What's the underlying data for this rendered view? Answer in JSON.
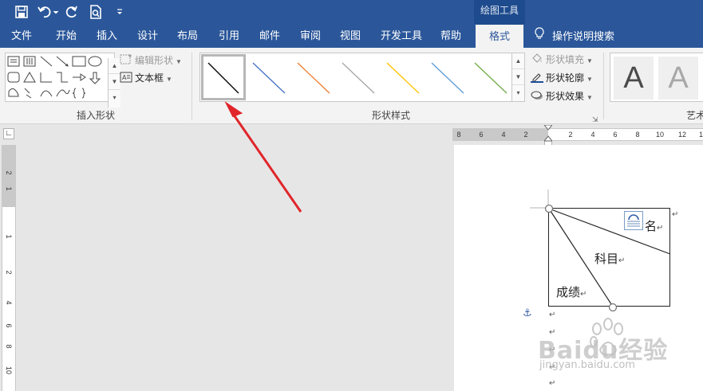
{
  "title_bar": {
    "contextual_group": "绘图工具"
  },
  "tabs": [
    {
      "label": "文件"
    },
    {
      "label": "开始"
    },
    {
      "label": "插入"
    },
    {
      "label": "设计"
    },
    {
      "label": "布局"
    },
    {
      "label": "引用"
    },
    {
      "label": "邮件"
    },
    {
      "label": "审阅"
    },
    {
      "label": "视图"
    },
    {
      "label": "开发工具"
    },
    {
      "label": "帮助"
    },
    {
      "label": "格式"
    }
  ],
  "active_tab": "格式",
  "tell_me": "操作说明搜索",
  "ribbon": {
    "insert_shapes": {
      "group_label": "插入形状",
      "edit_shape": "编辑形状",
      "text_box": "文本框"
    },
    "shape_styles": {
      "group_label": "形状样式",
      "line_colors": [
        "#000000",
        "#4472c4",
        "#ed7d31",
        "#a5a5a5",
        "#ffc000",
        "#5b9bd5",
        "#70ad47"
      ],
      "shape_fill": "形状填充",
      "shape_outline": "形状轮廓",
      "shape_effects": "形状效果"
    },
    "wordart_styles": {
      "group_label": "艺术",
      "sample": "A"
    }
  },
  "horizontal_ruler": [
    "8",
    "6",
    "4",
    "2",
    "",
    "2",
    "4",
    "6",
    "8",
    "10",
    "12",
    "14"
  ],
  "vertical_ruler": [
    "2",
    "1",
    "",
    "1",
    "2",
    "4",
    "6",
    "8",
    "10"
  ],
  "document": {
    "header_cell": {
      "name_label": "名",
      "subject_label": "科目",
      "score_label": "成绩"
    }
  },
  "watermark": {
    "brand": "Baidu经验",
    "url": "jingyan.baidu.com"
  }
}
